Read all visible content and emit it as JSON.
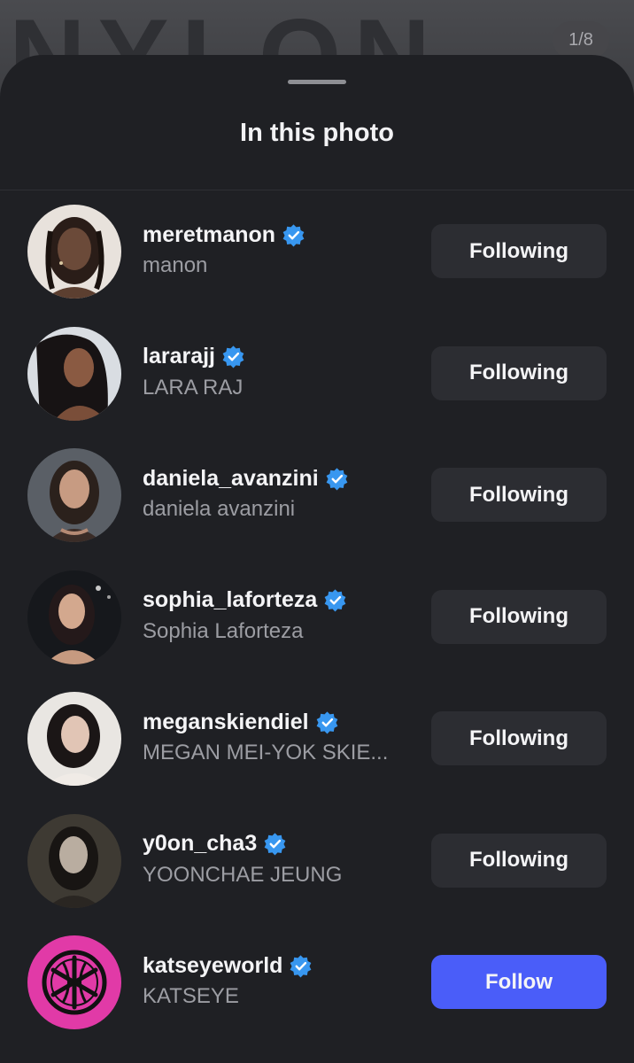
{
  "backdrop": {
    "letters": "NYLON",
    "counter": "1/8"
  },
  "sheet": {
    "title": "In this photo"
  },
  "people": [
    {
      "username": "meretmanon",
      "fullname": "manon",
      "button": "Following",
      "verified": true
    },
    {
      "username": "lararajj",
      "fullname": "LARA RAJ",
      "button": "Following",
      "verified": true
    },
    {
      "username": "daniela_avanzini",
      "fullname": "daniela avanzini",
      "button": "Following",
      "verified": true
    },
    {
      "username": "sophia_laforteza",
      "fullname": "Sophia Laforteza",
      "button": "Following",
      "verified": true
    },
    {
      "username": "meganskiendiel",
      "fullname": "MEGAN MEI-YOK SKIE...",
      "button": "Following",
      "verified": true
    },
    {
      "username": "y0on_cha3",
      "fullname": "YOONCHAE JEUNG",
      "button": "Following",
      "verified": true
    },
    {
      "username": "katseyeworld",
      "fullname": "KATSEYE",
      "button": "Follow",
      "verified": true
    }
  ],
  "colors": {
    "sheet_background": "#1f2024",
    "following_button": "#2c2d32",
    "follow_button": "#4a5df9",
    "verified_badge": "#3897f0",
    "katseye_avatar": "#e13aa7"
  },
  "icons": {
    "verified": "verified-badge-icon"
  }
}
